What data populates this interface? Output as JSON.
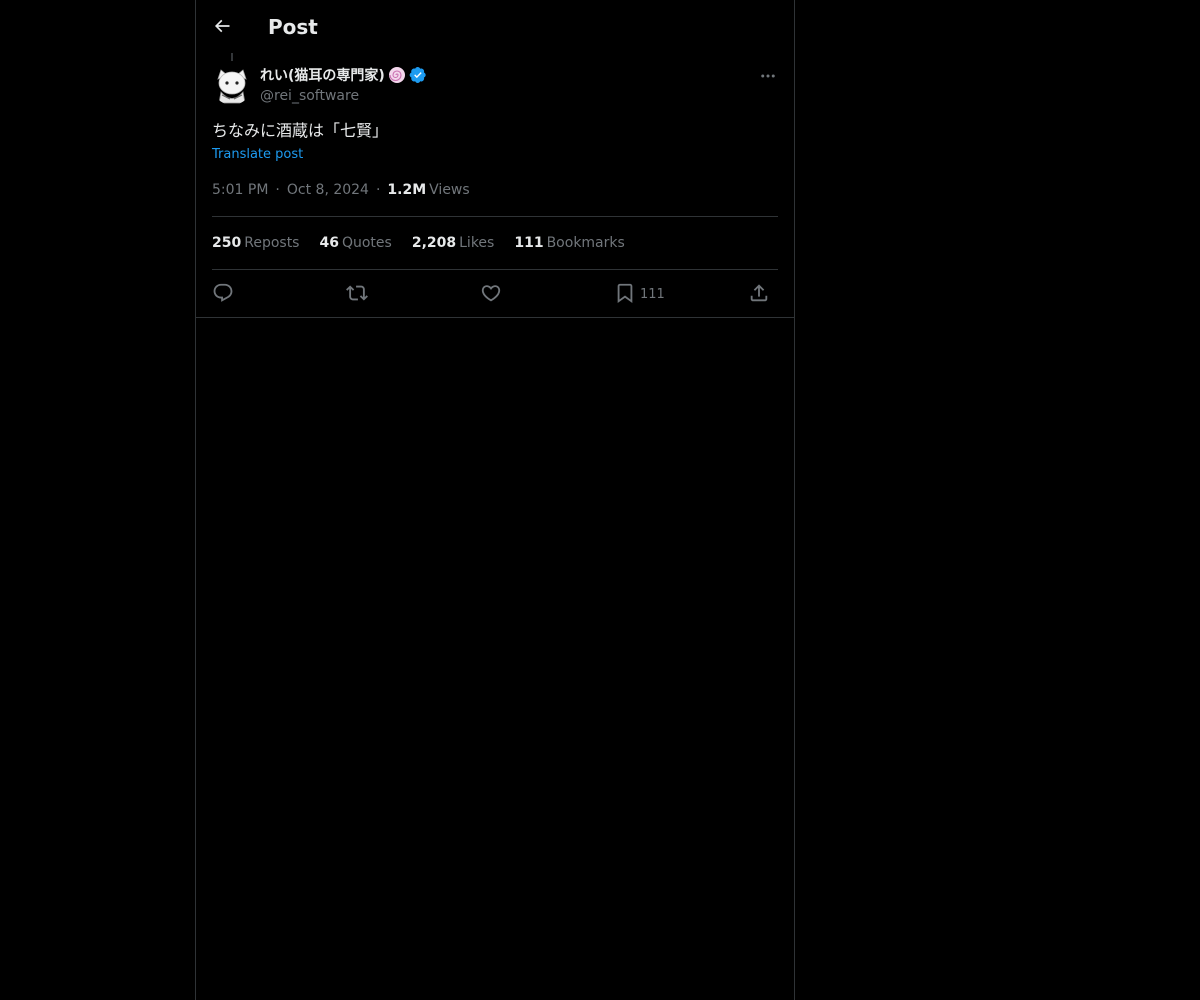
{
  "header": {
    "title": "Post"
  },
  "post": {
    "display_name": "れい(猫耳の専門家)",
    "handle": "@rei_software",
    "text": "ちなみに酒蔵は「七賢」",
    "translate_label": "Translate post",
    "time": "5:01 PM",
    "date": "Oct 8, 2024",
    "views_count": "1.2M",
    "views_label": "Views"
  },
  "stats": {
    "reposts_count": "250",
    "reposts_label": "Reposts",
    "quotes_count": "46",
    "quotes_label": "Quotes",
    "likes_count": "2,208",
    "likes_label": "Likes",
    "bookmarks_count": "111",
    "bookmarks_label": "Bookmarks"
  },
  "actions": {
    "bookmark_count": "111"
  },
  "icons": {
    "back": "arrow-left-icon",
    "more": "more-horizontal-icon",
    "verified": "verified-badge-icon",
    "emoji": "swirl-emoji-icon",
    "reply": "reply-icon",
    "repost": "repost-icon",
    "like": "heart-icon",
    "bookmark": "bookmark-icon",
    "share": "share-icon"
  },
  "colors": {
    "background": "#000000",
    "text_primary": "#e7e9ea",
    "text_secondary": "#71767b",
    "accent": "#1d9bf0",
    "border": "#2f3336"
  }
}
